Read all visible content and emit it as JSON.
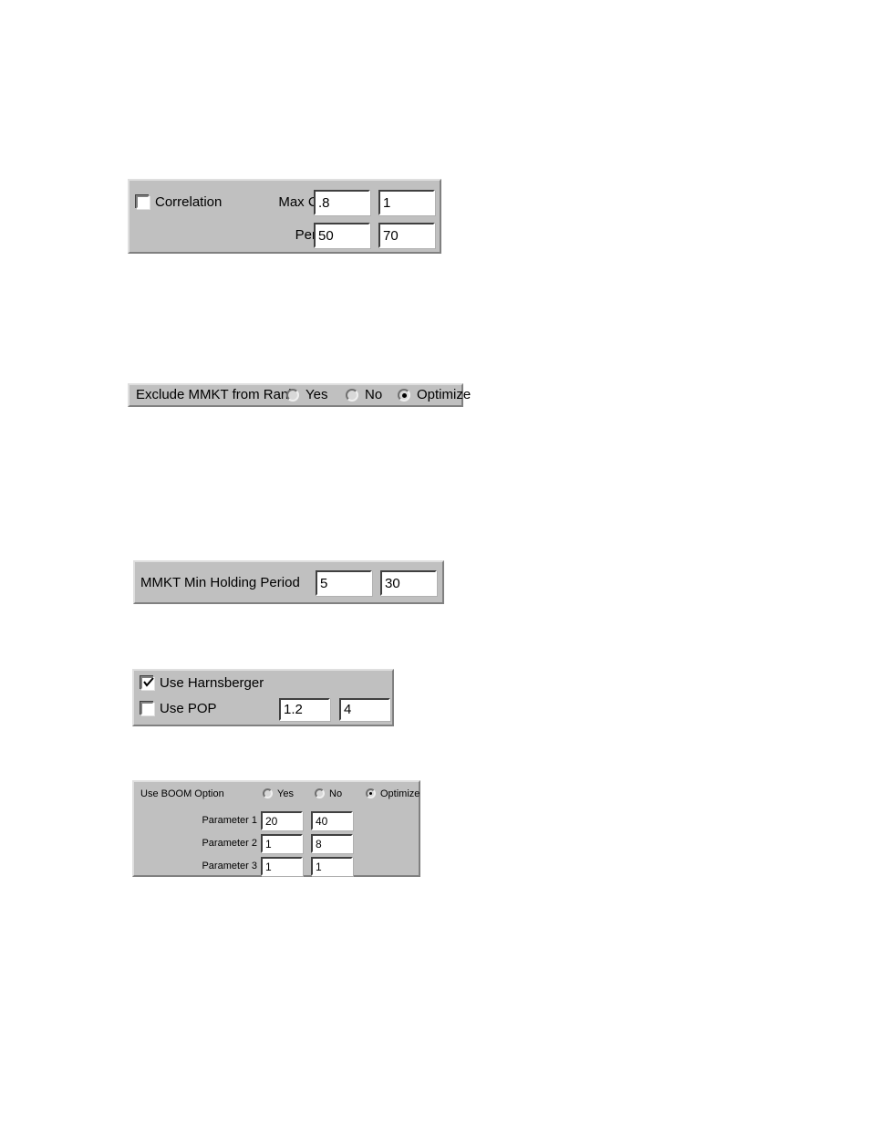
{
  "correlation_panel": {
    "checkbox": {
      "label": "Correlation",
      "checked": false
    },
    "rows": [
      {
        "label": "Max Corr",
        "value_low": ".8",
        "value_high": "1"
      },
      {
        "label": "Period",
        "value_low": "50",
        "value_high": "70"
      }
    ]
  },
  "exclude_mmkt_panel": {
    "label": "Exclude MMKT from Rank",
    "options": [
      {
        "label": "Yes",
        "selected": false
      },
      {
        "label": "No",
        "selected": false
      },
      {
        "label": "Optimize",
        "selected": true
      }
    ]
  },
  "mmkt_holding_panel": {
    "label": "MMKT Min Holding Period",
    "value_low": "5",
    "value_high": "30"
  },
  "harnsberger_panel": {
    "harnsberger": {
      "label": "Use Harnsberger",
      "checked": true
    },
    "pop": {
      "label": "Use POP",
      "checked": false,
      "value_low": "1.2",
      "value_high": "4"
    }
  },
  "boom_panel": {
    "title": "Use BOOM Option",
    "options": [
      {
        "label": "Yes",
        "selected": false
      },
      {
        "label": "No",
        "selected": false
      },
      {
        "label": "Optimize",
        "selected": true
      }
    ],
    "parameters": [
      {
        "label": "Parameter 1",
        "value_low": "20",
        "value_high": "40"
      },
      {
        "label": "Parameter 2",
        "value_low": "1",
        "value_high": "8"
      },
      {
        "label": "Parameter 3",
        "value_low": "1",
        "value_high": "1"
      }
    ]
  },
  "colors": {
    "panel_face": "#c0c0c0",
    "page_background": "#ffffff",
    "field_background": "#ffffff",
    "text": "#000000"
  }
}
